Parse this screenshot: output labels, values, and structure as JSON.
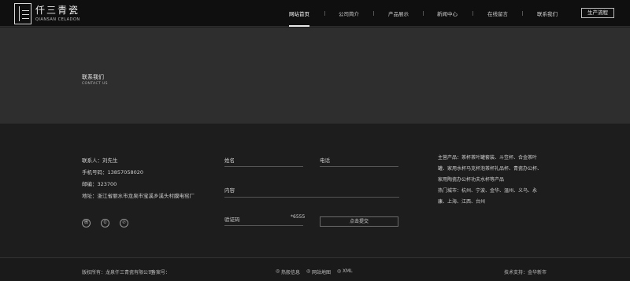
{
  "brand": {
    "name_cn": "仟三青瓷",
    "name_en": "QIANSAN CELADON"
  },
  "nav": {
    "items": [
      {
        "label": "网站首页",
        "active": true
      },
      {
        "label": "公司简介",
        "active": false
      },
      {
        "label": "产品展示",
        "active": false
      },
      {
        "label": "新闻中心",
        "active": false
      },
      {
        "label": "在线留言",
        "active": false
      },
      {
        "label": "联系我们",
        "active": false
      }
    ],
    "cta": "生产流程"
  },
  "banner": {
    "title": "联系我们",
    "subtitle": "CONTACT US"
  },
  "contact": {
    "contact_person": "联系人：刘先生",
    "phone": "手机号码：13857058020",
    "email": "邮编：323700",
    "address": "地址：浙江省丽水市龙泉市宝溪乡溪头村膜电窑厂"
  },
  "social": [
    "weibo-icon",
    "qq-icon",
    "wechat-icon"
  ],
  "form": {
    "name_label": "姓名",
    "phone_label": "电话",
    "content_label": "内容",
    "captcha_label": "验证码",
    "captcha_value": "*6555",
    "submit": "点击提交"
  },
  "products": {
    "main": "主营产品：茶杯茶叶罐套装、斗笠杯、合金茶叶罐、家用水杯马克杯泡茶杯礼品杯、青瓷办公杯、家用陶瓷办公杯功夫水杯等产品",
    "cities": "热门城市：杭州、宁波、金华、温州、义乌、永康、上海、江西、台州"
  },
  "footer": {
    "copyright": "版权所有：龙泉仟三青瓷有限公司",
    "icp": "备案号：",
    "hot": "热般信息",
    "sitemap": "网站地图",
    "xml": "XML",
    "tech": "技术支持：金华新市"
  }
}
